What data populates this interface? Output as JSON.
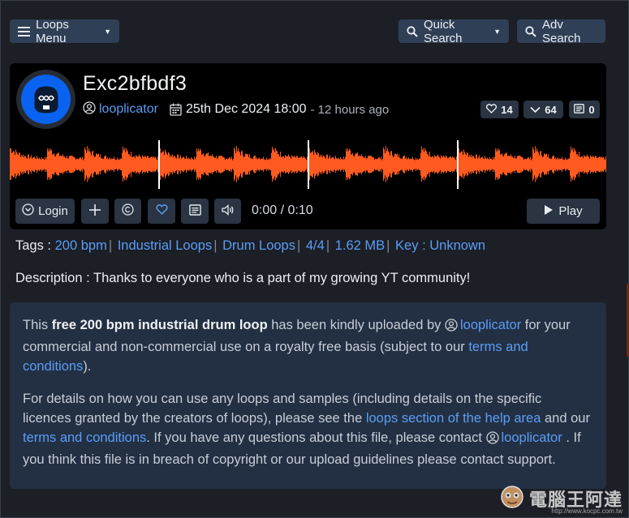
{
  "nav": {
    "loops_menu_label": "Loops Menu",
    "quick_search_label": "Quick Search",
    "adv_search_label": "Adv Search"
  },
  "loop": {
    "title": "Exc2bfbdf3",
    "user": "looplicator",
    "date": "25th Dec 2024 18:00",
    "ago": "- 12 hours ago",
    "likes": "14",
    "votes": "64",
    "comments": "0"
  },
  "player": {
    "login_label": "Login",
    "time": "0:00 / 0:10",
    "play_label": "Play",
    "wave_color": "#ff5a1f"
  },
  "tags": {
    "label": "Tags : ",
    "items": [
      "200 bpm",
      "Industrial Loops",
      "Drum Loops",
      "4/4",
      "1.62 MB",
      "Key : Unknown"
    ]
  },
  "description": "Description : Thanks to everyone who is a part of my growing YT community!",
  "info": {
    "p1_a": "This ",
    "p1_strong": "free 200 bpm industrial drum loop",
    "p1_b": " has been kindly uploaded by ",
    "p1_user": "looplicator",
    "p1_c": "  for your commercial and non-commercial use on a royalty free basis (subject to our ",
    "p1_terms": "terms and conditions",
    "p1_d": ").",
    "p2_a": "For details on how you can use any loops and samples (including details on the specific licences granted by the creators of loops), please see the ",
    "p2_help": "loops section of the help area",
    "p2_b": " and our ",
    "p2_terms": "terms and conditions",
    "p2_c": ". If you have any questions about this file, please contact ",
    "p2_user": "looplicator",
    "p2_d": " . If you think this file is in breach of copyright or our upload guidelines please contact support."
  },
  "watermark": {
    "text": "電腦王阿達",
    "url": "http://www.kocpc.com.tw"
  }
}
